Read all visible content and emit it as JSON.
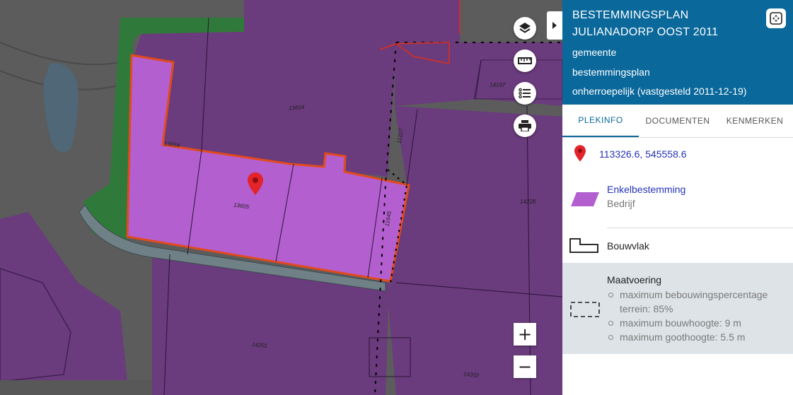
{
  "map": {
    "parcels": [
      "13604",
      "13654",
      "13605",
      "11227",
      "11645",
      "14197",
      "14228",
      "14201",
      "14202"
    ],
    "zoom_in": "+",
    "zoom_out": "−"
  },
  "panel": {
    "title_line1": "BESTEMMINGSPLAN",
    "title_line2": "JULIANADORP OOST 2011",
    "gemeente": "gemeente",
    "type": "bestemmingsplan",
    "status": "onherroepelijk (vastgesteld 2011-12-19)",
    "tabs": [
      "PLEKINFO",
      "DOCUMENTEN",
      "KENMERKEN"
    ],
    "coordinates": "113326.6, 545558.6",
    "bestemming_title": "Enkelbestemming",
    "bestemming_sub": "Bedrijf",
    "bouwvlak": "Bouwvlak",
    "maatvoering_title": "Maatvoering",
    "maatvoering_items": [
      "maximum bebouwingspercentage terrein: 85%",
      "maximum bouwhoogte: 9 m",
      "maximum goothoogte: 5.5 m"
    ]
  },
  "colors": {
    "header": "#0a689b",
    "bedrijf": "#b35fcf",
    "purple_dark": "#6a3b7d",
    "green": "#2f7a3a",
    "marker": "#e3242b"
  }
}
